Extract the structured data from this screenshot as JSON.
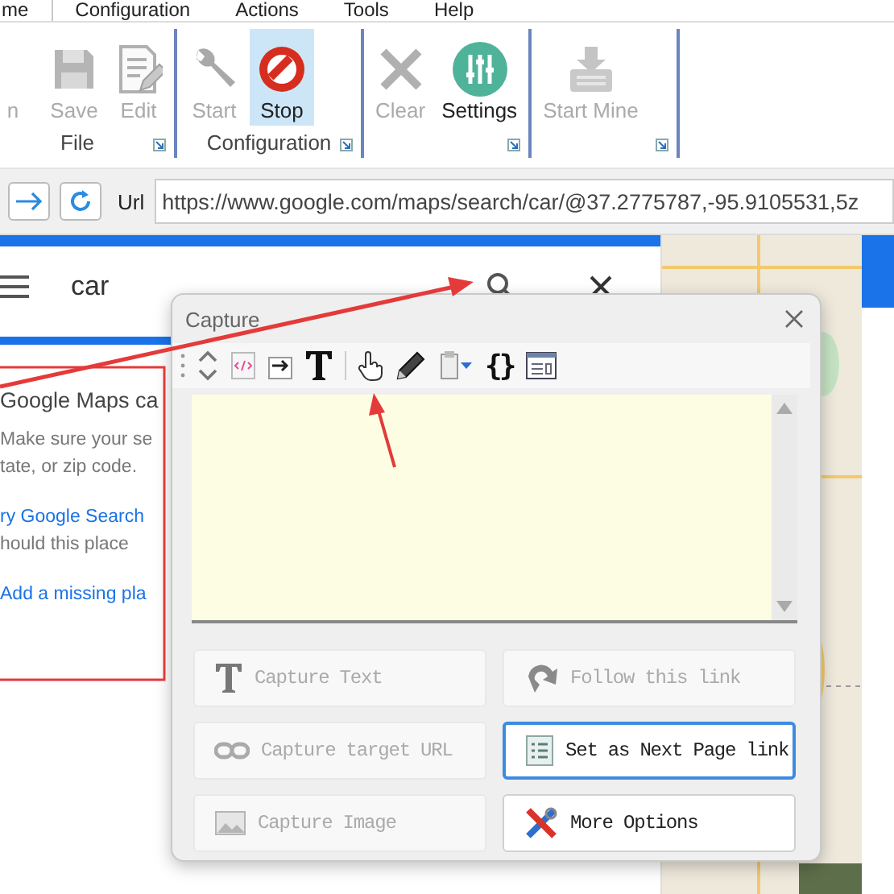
{
  "menu_tabs": [
    {
      "label": "me",
      "selected": true
    },
    {
      "label": "Configuration",
      "selected": false
    },
    {
      "label": "Actions",
      "selected": false
    },
    {
      "label": "Tools",
      "selected": false
    },
    {
      "label": "Help",
      "selected": false
    }
  ],
  "ribbon_groups": [
    {
      "label": "File",
      "buttons": [
        {
          "label": "n",
          "disabled": true,
          "selected": false
        },
        {
          "label": "Save",
          "disabled": true,
          "selected": false
        },
        {
          "label": "Edit",
          "disabled": true,
          "selected": false
        }
      ]
    },
    {
      "label": "Configuration",
      "buttons": [
        {
          "label": "Start",
          "disabled": true,
          "selected": false
        },
        {
          "label": "Stop",
          "disabled": false,
          "selected": true
        }
      ]
    },
    {
      "buttons": [
        {
          "label": "Clear",
          "disabled": true,
          "selected": false
        },
        {
          "label": "Settings",
          "disabled": false,
          "selected": false
        }
      ]
    },
    {
      "buttons": [
        {
          "label": "Start Mine",
          "disabled": true,
          "selected": false
        }
      ]
    }
  ],
  "address_bar": {
    "label": "Url",
    "value": "https://www.google.com/maps/search/car/@37.2775787,-95.9105531,5z"
  },
  "maps_pane": {
    "search_value": "car",
    "results": [
      {
        "kind": "heading",
        "text": "Google Maps ca"
      },
      {
        "kind": "text",
        "text": "Make sure your se"
      },
      {
        "kind": "text",
        "text": "tate, or zip code."
      },
      {
        "kind": "link",
        "text": "ry Google Search"
      },
      {
        "kind": "text",
        "text": "hould this place"
      },
      {
        "kind": "link",
        "text": "Add a missing pla"
      }
    ]
  },
  "capture_dialog": {
    "title": "Capture",
    "toolbar": [
      {
        "kind": "grip"
      },
      {
        "kind": "updown"
      },
      {
        "kind": "html"
      },
      {
        "kind": "arrowbox"
      },
      {
        "kind": "bigt"
      },
      {
        "kind": "sep"
      },
      {
        "kind": "hand"
      },
      {
        "kind": "pencil"
      },
      {
        "kind": "clipboard"
      },
      {
        "kind": "text",
        "text": "{}"
      },
      {
        "kind": "window"
      }
    ],
    "buttons": [
      {
        "label": "Capture Text",
        "disabled": true,
        "focused": false
      },
      {
        "label": "Follow this link",
        "disabled": true,
        "focused": false
      },
      {
        "label": "Capture target URL",
        "disabled": true,
        "focused": false
      },
      {
        "label": "Set as Next Page link",
        "disabled": false,
        "focused": true
      },
      {
        "label": "Capture Image",
        "disabled": true,
        "focused": false
      },
      {
        "label": "More Options",
        "disabled": false,
        "focused": false
      }
    ]
  }
}
